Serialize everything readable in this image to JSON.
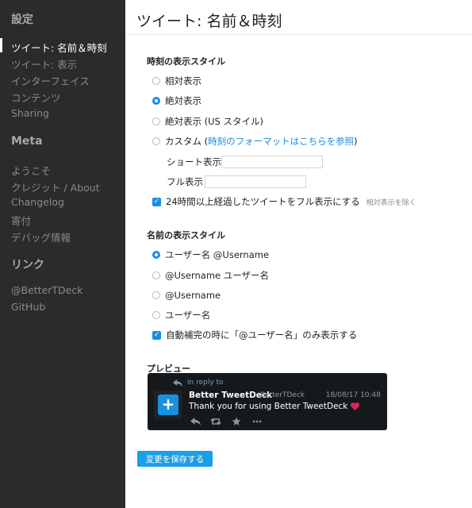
{
  "sidebar": {
    "settings_heading": "設定",
    "settings_items": [
      {
        "label": "ツイート: 名前＆時刻",
        "active": true
      },
      {
        "label": "ツイート: 表示"
      },
      {
        "label": "インターフェイス"
      },
      {
        "label": "コンテンツ"
      },
      {
        "label": "Sharing"
      }
    ],
    "meta_heading": "Meta",
    "meta_items": [
      {
        "label": "ようこそ"
      },
      {
        "label": "クレジット / About"
      },
      {
        "label": "Changelog"
      },
      {
        "label": "寄付"
      },
      {
        "label": "デバッグ情報"
      }
    ],
    "links_heading": "リンク",
    "link_items": [
      {
        "label": "@BetterTDeck"
      },
      {
        "label": "GitHub"
      }
    ]
  },
  "main": {
    "title": "ツイート: 名前＆時刻",
    "time_section": {
      "heading": "時刻の表示スタイル",
      "options": [
        {
          "label": "相対表示",
          "checked": false
        },
        {
          "label": "絶対表示",
          "checked": true
        },
        {
          "label": "絶対表示 (US スタイル)",
          "checked": false
        }
      ],
      "custom": {
        "label_prefix": "カスタム (",
        "link": "時刻のフォーマットはこちらを参照",
        "label_suffix": ")",
        "checked": false
      },
      "short_label": "ショート表示",
      "short_value": "",
      "full_label": "フル表示",
      "full_value": "",
      "full_after_24h": {
        "label": "24時間以上経過したツイートをフル表示にする",
        "hint": "相対表示を除く",
        "checked": true
      }
    },
    "name_section": {
      "heading": "名前の表示スタイル",
      "options": [
        {
          "label": "ユーザー名 @Username",
          "checked": true
        },
        {
          "label": "@Username ユーザー名",
          "checked": false
        },
        {
          "label": "@Username",
          "checked": false
        },
        {
          "label": "ユーザー名",
          "checked": false
        }
      ],
      "autocomplete": {
        "label": "自動補完の時に「@ユーザー名」のみ表示する",
        "checked": true
      }
    },
    "preview": {
      "heading": "プレビュー",
      "in_reply_to": "in reply to",
      "name": "Better TweetDeck",
      "handle": "BetterTDeck",
      "time": "18/08/17 10:48",
      "text": "Thank you for using Better TweetDeck",
      "avatar_glyph": "+"
    },
    "save_label": "変更を保存する"
  },
  "colors": {
    "accent": "#1a8fe0",
    "sidebar_bg": "#2b2b2b",
    "preview_bg": "#16191c",
    "heart": "#e0245e"
  },
  "icons": [
    "reply-icon",
    "retweet-icon",
    "favorite-icon",
    "more-icon",
    "heart-icon",
    "check-icon"
  ]
}
